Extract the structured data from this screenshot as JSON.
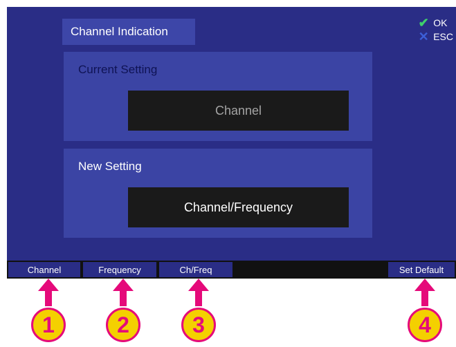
{
  "header": {
    "title": "Channel Indication"
  },
  "dialog_actions": {
    "ok": "OK",
    "esc": "ESC"
  },
  "current_setting": {
    "label": "Current Setting",
    "value": "Channel"
  },
  "new_setting": {
    "label": "New Setting",
    "value": "Channel/Frequency"
  },
  "softkeys": [
    "Channel",
    "Frequency",
    "Ch/Freq",
    "Set Default"
  ],
  "callouts": [
    "1",
    "2",
    "3",
    "4"
  ],
  "colors": {
    "screen_bg": "#2a2d86",
    "panel_bg": "#3b44a4",
    "callout_fill": "#f4d000",
    "callout_accent": "#e50a7a",
    "ok_check": "#3fd06c",
    "esc_x": "#3c5fd8"
  },
  "icons": {
    "ok": "checkmark-icon",
    "esc": "x-icon",
    "callout": "arrow-up-icon"
  }
}
